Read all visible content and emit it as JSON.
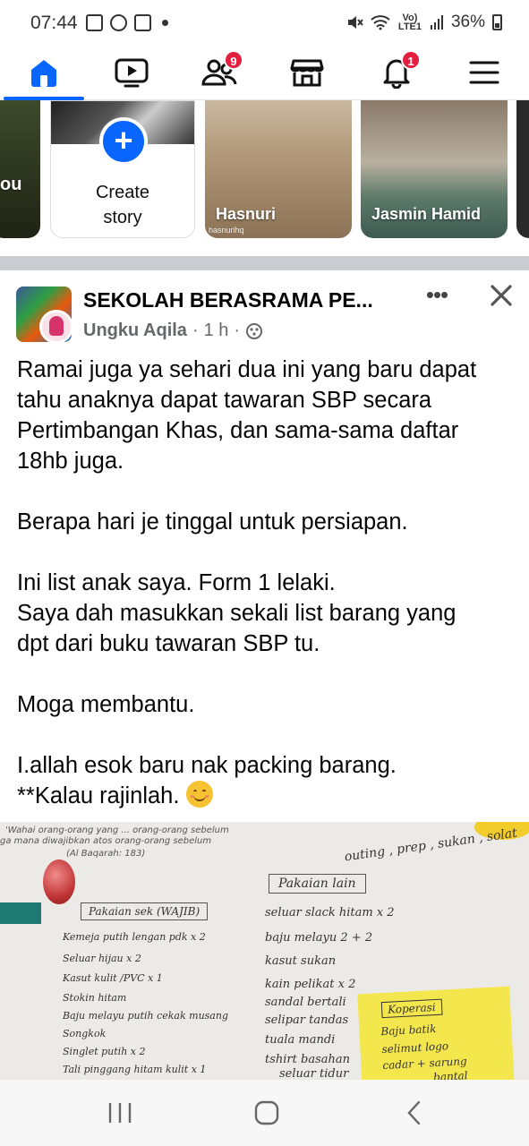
{
  "status_bar": {
    "time": "07:44",
    "network": "Vo) LTE1",
    "battery": "36%"
  },
  "nav": {
    "items": [
      {
        "name": "home",
        "badge": ""
      },
      {
        "name": "watch",
        "badge": ""
      },
      {
        "name": "friends",
        "badge": "9"
      },
      {
        "name": "marketplace",
        "badge": ""
      },
      {
        "name": "notifications",
        "badge": "1"
      },
      {
        "name": "menu",
        "badge": ""
      }
    ],
    "accent": "#0866ff",
    "badge_color": "#e41e3f"
  },
  "stories": {
    "partial_left_label": "ou",
    "create_label_line1": "Create",
    "create_label_line2": "story",
    "items": [
      {
        "name": "Hasnuri",
        "sub": "hasnurihq"
      },
      {
        "name": "Jasmin Hamid",
        "sub": ""
      }
    ]
  },
  "post": {
    "group_name": "SEKOLAH BERASRAMA PE...",
    "author": "Ungku Aqila",
    "time": "1 h",
    "lines": [
      "Ramai juga ya sehari dua ini yang baru dapat",
      "tahu anaknya dapat tawaran SBP secara",
      "Pertimbangan Khas, dan sama-sama daftar",
      "18hb juga.",
      "",
      "Berapa hari je tinggal untuk persiapan.",
      "",
      "Ini list anak saya. Form 1 lelaki.",
      "Saya dah masukkan sekali list barang yang",
      "dpt dari buku tawaran SBP tu.",
      "",
      "Moga membantu.",
      "",
      "I.allah esok baru nak packing barang.",
      "**Kalau rajinlah."
    ],
    "photo": {
      "quote": "'Wahai orang-orang yang ... orang-orang sebelum",
      "quote2": "ga mana diwajibkan atos orang-orang sebelum",
      "quote_ref": "(Al Baqarah: 183)",
      "top_note": "outing , prep , sukan , solat",
      "left_title": "Pakaian sek (WAJIB)",
      "left_items": [
        "Kemeja putih lengan pdk x 2",
        "Seluar hijau x 2",
        "Kasut kulit /PVC x 1",
        "Stokin hitam",
        "Baju melayu putih cekak musang",
        "Songkok",
        "Singlet putih x 2",
        "Tali pinggang hitam kulit x 1"
      ],
      "right_title": "Pakaian lain",
      "right_items": [
        "seluar slack hitam x 2",
        "baju melayu 2 + 2",
        "kasut sukan",
        "kain pelikat x 2",
        "sandal bertali",
        "selipar tandas",
        "tuala mandi",
        "tshirt basahan",
        "seluar tidur"
      ],
      "sticky_title": "Koperasi",
      "sticky_items": [
        "Baju batik",
        "selimut logo",
        "cadar + sarung",
        "bantal"
      ]
    }
  }
}
